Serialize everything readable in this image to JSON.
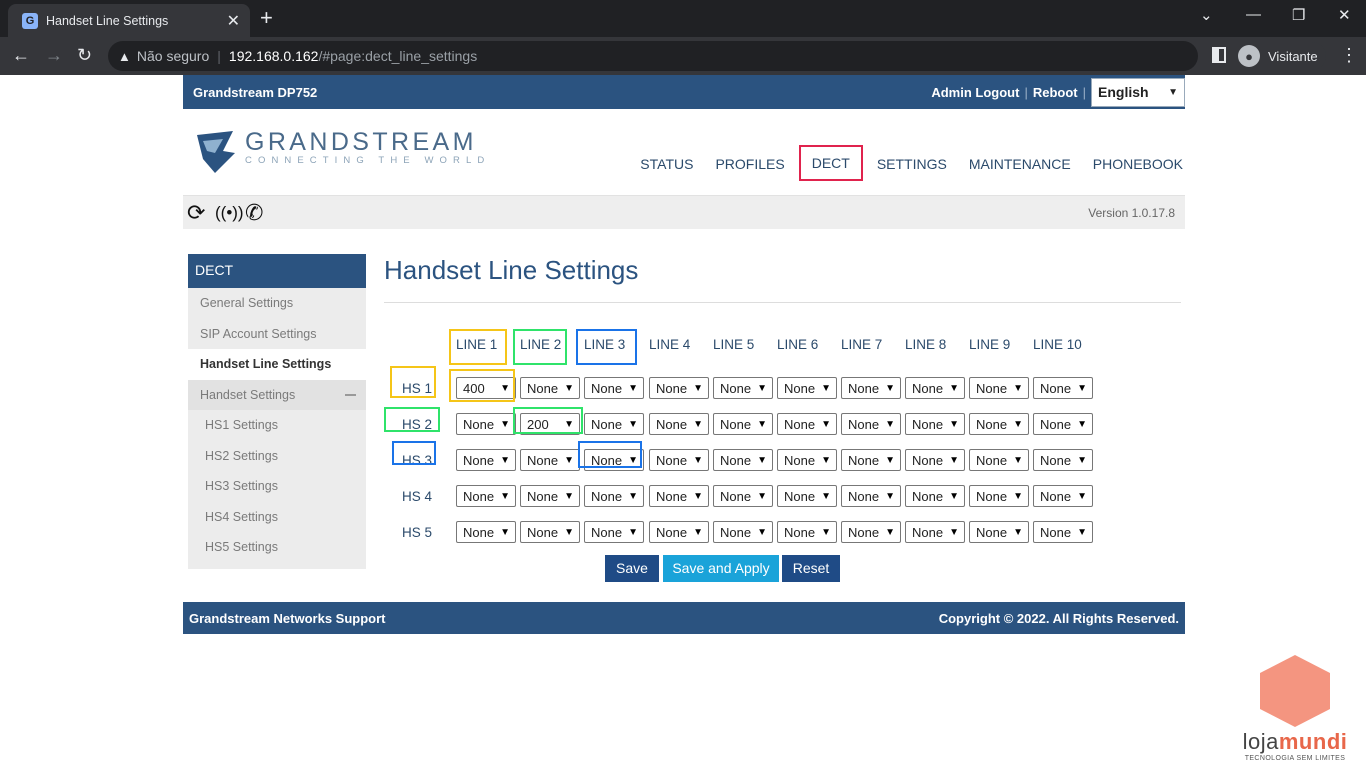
{
  "browser": {
    "tab_title": "Handset Line Settings",
    "favicon": "G",
    "insecure_label": "Não seguro",
    "url_host": "192.168.0.162",
    "url_path": "/#page:dect_line_settings",
    "profile_name": "Visitante",
    "profile_initial": "●"
  },
  "topbar": {
    "brand": "Grandstream DP752",
    "admin_logout": "Admin Logout",
    "reboot": "Reboot",
    "separator": "|",
    "language": "English"
  },
  "logo": {
    "name": "GRANDSTREAM",
    "tagline": "CONNECTING THE WORLD"
  },
  "nav": [
    "STATUS",
    "PROFILES",
    "DECT",
    "SETTINGS",
    "MAINTENANCE",
    "PHONEBOOK"
  ],
  "toolbar": {
    "version": "Version 1.0.17.8"
  },
  "sidebar": {
    "header": "DECT",
    "general": "General Settings",
    "sip": "SIP Account Settings",
    "handset_line": "Handset Line Settings",
    "handset_settings": "Handset Settings",
    "hs1": "HS1 Settings",
    "hs2": "HS2 Settings",
    "hs3": "HS3 Settings",
    "hs4": "HS4 Settings",
    "hs5": "HS5 Settings"
  },
  "page_title": "Handset Line Settings",
  "lines": [
    "LINE 1",
    "LINE 2",
    "LINE 3",
    "LINE 4",
    "LINE 5",
    "LINE 6",
    "LINE 7",
    "LINE 8",
    "LINE 9",
    "LINE 10"
  ],
  "handsets": [
    {
      "label": "HS 1",
      "values": [
        "400",
        "None",
        "None",
        "None",
        "None",
        "None",
        "None",
        "None",
        "None",
        "None"
      ]
    },
    {
      "label": "HS 2",
      "values": [
        "None",
        "200",
        "None",
        "None",
        "None",
        "None",
        "None",
        "None",
        "None",
        "None"
      ]
    },
    {
      "label": "HS 3",
      "values": [
        "None",
        "None",
        "None",
        "None",
        "None",
        "None",
        "None",
        "None",
        "None",
        "None"
      ]
    },
    {
      "label": "HS 4",
      "values": [
        "None",
        "None",
        "None",
        "None",
        "None",
        "None",
        "None",
        "None",
        "None",
        "None"
      ]
    },
    {
      "label": "HS 5",
      "values": [
        "None",
        "None",
        "None",
        "None",
        "None",
        "None",
        "None",
        "None",
        "None",
        "None"
      ]
    }
  ],
  "buttons": {
    "save": "Save",
    "save_apply": "Save and Apply",
    "reset": "Reset"
  },
  "footer": {
    "support": "Grandstream Networks Support",
    "copyright": "Copyright © 2022. All Rights Reserved."
  },
  "watermark": {
    "name_a": "loja",
    "name_b": "mundi",
    "tagline": "TECNOLOGIA SEM LIMITES"
  },
  "colors": {
    "brand_blue": "#2b5380",
    "highlight_yellow": "#f5c518",
    "highlight_green": "#2fe36a",
    "highlight_blue": "#1a73e8",
    "nav_active_red": "#e0234d",
    "save_apply": "#1aa3d9"
  }
}
